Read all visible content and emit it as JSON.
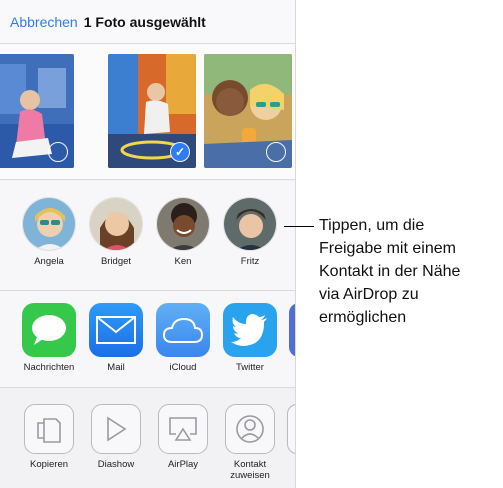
{
  "header": {
    "cancel_label": "Abbrechen",
    "title": "1 Foto ausgewählt"
  },
  "photos": [
    {
      "selected": false
    },
    {
      "selected": true
    },
    {
      "selected": false
    }
  ],
  "airdrop": {
    "contacts": [
      {
        "name": "Angela"
      },
      {
        "name": "Bridget"
      },
      {
        "name": "Ken"
      },
      {
        "name": "Fritz"
      }
    ]
  },
  "apps": [
    {
      "label": "Nachrichten",
      "icon": "speech-bubble-icon",
      "color": "#34c84a"
    },
    {
      "label": "Mail",
      "icon": "envelope-icon",
      "color": "#2a86f0"
    },
    {
      "label": "iCloud",
      "icon": "cloud-icon",
      "color": "#4a9ef2"
    },
    {
      "label": "Twitter",
      "icon": "bird-icon",
      "color": "#2aa3ef"
    }
  ],
  "actions": [
    {
      "label": "Kopieren",
      "icon": "copy-icon"
    },
    {
      "label": "Diashow",
      "icon": "play-icon"
    },
    {
      "label": "AirPlay",
      "icon": "airplay-icon"
    },
    {
      "label": "Kontakt zuweisen",
      "icon": "person-icon"
    }
  ],
  "callout": {
    "lines": [
      "Tippen, um die",
      "Freigabe mit einem",
      "Kontakt in der Nähe",
      "via AirDrop zu",
      "ermöglichen"
    ]
  },
  "colors": {
    "accent": "#2e7cf6"
  }
}
